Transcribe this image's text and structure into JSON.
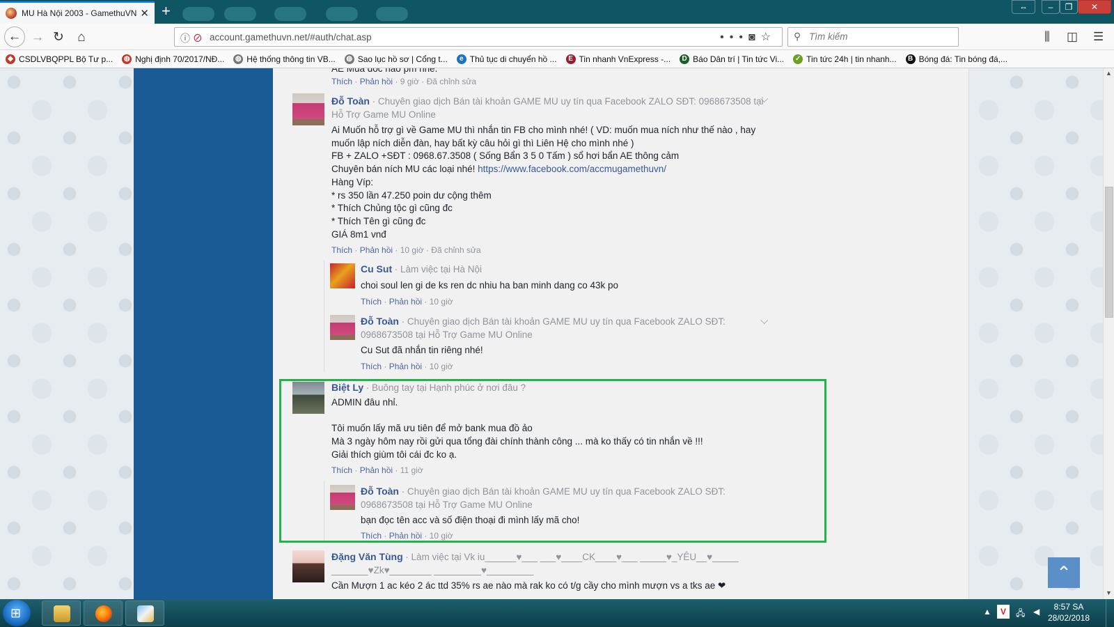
{
  "browser": {
    "tab_title": "MU Hà Nội 2003 - GamethuVN",
    "url_domain": "account.gamethuvn.net",
    "url_path": "/#auth/chat.asp",
    "search_placeholder": "Tìm kiếm"
  },
  "bookmarks": [
    {
      "label": "CSDLVBQPPL Bộ Tư p...",
      "icon": "shield-icon",
      "color": "#c0392b"
    },
    {
      "label": "Nghị định 70/2017/NĐ...",
      "icon": "globe-icon",
      "color": "#c0392b"
    },
    {
      "label": "Hệ thống thông tin VB...",
      "icon": "globe-icon",
      "color": "#777777"
    },
    {
      "label": "Sao lục hồ sơ | Cổng t...",
      "icon": "globe-icon",
      "color": "#777777"
    },
    {
      "label": "Thủ tục di chuyển hồ ...",
      "icon": "ie-icon",
      "color": "#1e73be"
    },
    {
      "label": "Tin nhanh VnExpress -...",
      "icon": "e-icon",
      "color": "#9b1c2e"
    },
    {
      "label": "Báo Dân trí | Tin tức Vi...",
      "icon": "d-icon",
      "color": "#1a5e2a"
    },
    {
      "label": "Tin tức 24h | tin nhanh...",
      "icon": "check-icon",
      "color": "#6aa121"
    },
    {
      "label": "Bóng đá: Tin bóng đá,...",
      "icon": "b-icon",
      "color": "#111111"
    }
  ],
  "comments": {
    "top_partial_text": "AE Mua đóc nào pm nhé.",
    "top_meta": {
      "like": "Thích",
      "reply": "Phản hồi",
      "time": "9 giờ",
      "edited": "Đã chỉnh sửa"
    },
    "c1": {
      "name": "Đỗ Toàn",
      "subtitle": "Chuyên giao dịch Bán tài khoản GAME MU uy tín qua Facebook ZALO SĐT: 0968673508 tại Hỗ Trợ Game MU Online",
      "lines": [
        "Ai Muốn hỗ trợ gì về Game MU thì nhắn tin FB cho mình nhé! ( VD: muốn mua ních như thế nào , hay",
        "muốn lập ních diễn đàn, hay bất kỳ câu hỏi gì thì Liên Hệ cho mình nhé )",
        "FB + ZALO +SĐT : 0968.67.3508 ( Sống Bẩn 3 5 0 Tấm ) sổ hơi bẩn AE thông cảm",
        "Chuyên bán ních MU các loại nhé!",
        "Hàng Víp:",
        "* rs 350 lần 47.250 poin dư cộng thêm",
        "* Thích Chủng tộc gì cũng đc",
        "* Thích Tên gì cũng đc",
        "GIÁ 8m1 vnđ"
      ],
      "fb_link": "https://www.facebook.com/accmugamethuvn/",
      "like": "Thích",
      "reply": "Phản hồi",
      "time": "10 giờ",
      "edited": "Đã chỉnh sửa"
    },
    "r1": {
      "name": "Cu Sut",
      "subtitle": "Làm việc tại Hà Nội",
      "text": "choi soul len gi de ks ren dc nhiu ha ban minh dang co 43k po",
      "like": "Thích",
      "reply": "Phản hồi",
      "time": "10 giờ"
    },
    "r2": {
      "name": "Đỗ Toàn",
      "subtitle_a": "Chuyên giao dịch Bán tài khoản GAME MU uy tín qua Facebook ZALO SĐT:",
      "subtitle_b": "0968673508 tại Hỗ Trợ Game MU Online",
      "text": "Cu Sut đã nhắn tin riêng nhé!",
      "like": "Thích",
      "reply": "Phản hồi",
      "time": "10 giờ"
    },
    "c2": {
      "name": "Biệt Ly",
      "subtitle": "Buông tay tại Hạnh phúc ở nơi đâu ?",
      "lines": [
        "ADMIN đâu nhỉ.",
        "",
        "Tôi muốn lấy mã ưu tiên để mở bank mua đồ ảo",
        "Mà 3 ngày hôm nay rồi gửi qua tổng đài chính thành công ... mà ko thấy có tin nhắn về !!!",
        "Giải thích giùm tôi cái đc ko ạ."
      ],
      "like": "Thích",
      "reply": "Phản hồi",
      "time": "11 giờ"
    },
    "r3": {
      "name": "Đỗ Toàn",
      "subtitle_a": "Chuyên giao dịch Bán tài khoản GAME MU uy tín qua Facebook ZALO SĐT:",
      "subtitle_b": "0968673508 tại Hỗ Trợ Game MU Online",
      "text": "bạn đọc tên acc và số điện thoại đi mình lấy mã cho!",
      "like": "Thích",
      "reply": "Phản hồi",
      "time": "10 giờ"
    },
    "c3": {
      "name": "Đặng Văn Tùng",
      "subtitle_a": "Làm việc tại Vk iu______♥___ ___♥____CK____♥___ _____♥_YÊU__♥_____",
      "subtitle_b": "_______♥Zk♥________ _________♥_________",
      "text": "Cần Mượn 1 ac kéo 2 ác ttd 35% rs ae nào mà rak ko có t/g cầy cho mình mượn vs a tks ae ❤"
    }
  },
  "taskbar": {
    "time": "8:57 SA",
    "date": "28/02/2018"
  },
  "colors": {
    "highlight": "#21b24a",
    "link": "#365899",
    "sidebar": "#1a5b96"
  }
}
